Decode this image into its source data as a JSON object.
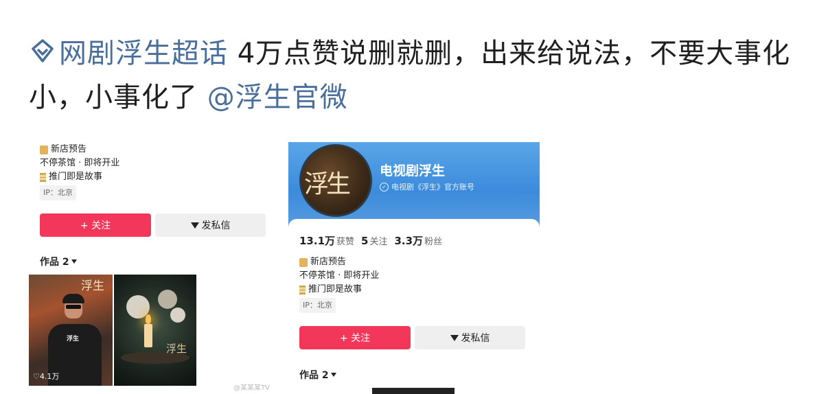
{
  "post": {
    "topic": "网剧浮生超话",
    "text": "  4万点赞说删就删，出来给说法，不要大事化小，小事化了 ",
    "mention": "@浮生官微"
  },
  "left_screenshot": {
    "bio": [
      "新店预告",
      "不停茶馆 · 即将开业",
      "推门即是故事"
    ],
    "ip": "IP：北京",
    "follow_label": "+ 关注",
    "dm_label": "发私信",
    "works_label": "作品 2",
    "thumb1": {
      "logo": "浮生",
      "like_count": "4.1万",
      "shirt_text": "浮生"
    },
    "thumb2": {
      "logo": "浮生"
    },
    "watermark": "@某某某TV"
  },
  "right_screenshot": {
    "account_name": "电视剧浮生",
    "verify_text": "电视剧《浮生》官方账号",
    "avatar_text": "浮生",
    "stats": [
      {
        "value": "13.1万",
        "label": "获赞"
      },
      {
        "value": "5",
        "label": "关注"
      },
      {
        "value": "3.3万",
        "label": "粉丝"
      }
    ],
    "bio": [
      "新店预告",
      "不停茶馆 · 即将开业",
      "推门即是故事"
    ],
    "ip": "IP：北京",
    "follow_label": "+ 关注",
    "dm_label": "发私信",
    "works_label": "作品 2"
  },
  "colors": {
    "accent_red": "#f2375a",
    "link_blue": "#4a6e9c",
    "header_blue": "#3c8bdc"
  }
}
